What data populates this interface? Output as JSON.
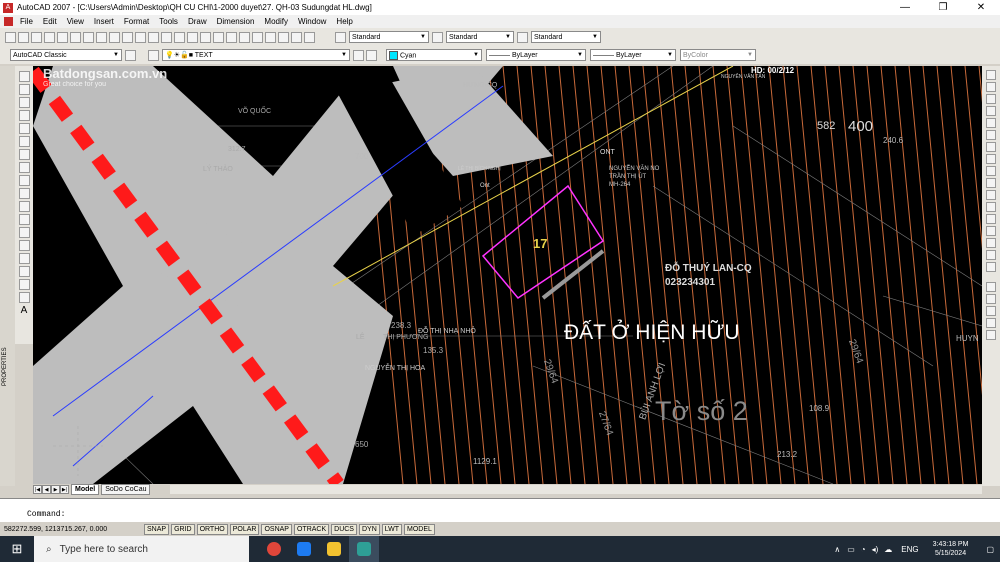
{
  "window": {
    "title": "AutoCAD 2007 - [C:\\Users\\Admin\\Desktop\\QH CU CHI\\1-2000 duyet\\27. QH-03 Sudungdat HL.dwg]",
    "minimize": "—",
    "maximize": "❐",
    "close": "✕"
  },
  "menu": [
    "File",
    "Edit",
    "View",
    "Insert",
    "Format",
    "Tools",
    "Draw",
    "Dimension",
    "Modify",
    "Window",
    "Help"
  ],
  "toolbar1": {
    "text_style": "Standard",
    "dim_style": "Standard",
    "table_style": "Standard"
  },
  "toolbar2": {
    "workspace": "AutoCAD Classic",
    "layer": "TEXT",
    "color": "Cyan",
    "linetype": "ByLayer",
    "lineweight": "ByLayer",
    "plotstyle": "ByColor"
  },
  "properties_label": "PROPERTIES",
  "watermark": {
    "line1": "Batdongsan.com.vn",
    "line2": "Great choice for you"
  },
  "drawing": {
    "labels": [
      {
        "text": "HƯNG-CQ"
      },
      {
        "text": "700"
      },
      {
        "text": "312.7"
      },
      {
        "text": "LÝ THẢO"
      },
      {
        "text": "VÕ QUỐC"
      },
      {
        "text": "HD: 00/2/12"
      },
      {
        "text": "NGUYỄN VĂN TÂN"
      },
      {
        "text": "582"
      },
      {
        "text": "400"
      },
      {
        "text": "240.6"
      },
      {
        "text": "ONT"
      },
      {
        "text": "NGUYỄN VĂN NO"
      },
      {
        "text": "TRẦN THỊ ÚT"
      },
      {
        "text": "MH-264"
      },
      {
        "text": "LÊ THỊ BÍCH NGHỊ"
      },
      {
        "text": "Ont"
      },
      {
        "text": "17"
      },
      {
        "text": "ĐỖ THUÝ LAN-CQ"
      },
      {
        "text": "023234301"
      },
      {
        "text": "ĐẤT Ở HIỆN HỮU"
      },
      {
        "text": "Tờ số 2"
      },
      {
        "text": "238.3"
      },
      {
        "text": "ĐỖ THỊ NHẠ NHỎ"
      },
      {
        "text": "135.3"
      },
      {
        "text": "NGUYỄN THỊ HOA"
      },
      {
        "text": "LÊ"
      },
      {
        "text": "THỊ PHƯƠNG"
      },
      {
        "text": "BÙI ANH LỢI"
      },
      {
        "text": "108.9"
      },
      {
        "text": "213.2"
      },
      {
        "text": "1129.1"
      },
      {
        "text": "650"
      },
      {
        "text": "29/64"
      },
      {
        "text": "27/64"
      },
      {
        "text": "29/64"
      },
      {
        "text": "HUYN"
      }
    ]
  },
  "tabs": {
    "model": "Model",
    "layout": "SoDo CoCau"
  },
  "command": {
    "line": "Command:"
  },
  "status": {
    "coords": "582272.599, 1213715.267, 0.000",
    "buttons": [
      "SNAP",
      "GRID",
      "ORTHO",
      "POLAR",
      "OSNAP",
      "OTRACK",
      "DUCS",
      "DYN",
      "LWT",
      "MODEL"
    ]
  },
  "taskbar": {
    "search_placeholder": "Type here to search",
    "language": "ENG",
    "time": "3:43:18 PM",
    "date": "5/15/2024"
  },
  "colors": {
    "red_dash": "#ff1a1a",
    "road": "#bdbdbd",
    "parcel_lines": "#c96a3a",
    "highlight": "#ff33ff",
    "yellow_text": "#e8d24a",
    "blue_line": "#2a3cff",
    "tray_bg": "#1f2a36"
  }
}
